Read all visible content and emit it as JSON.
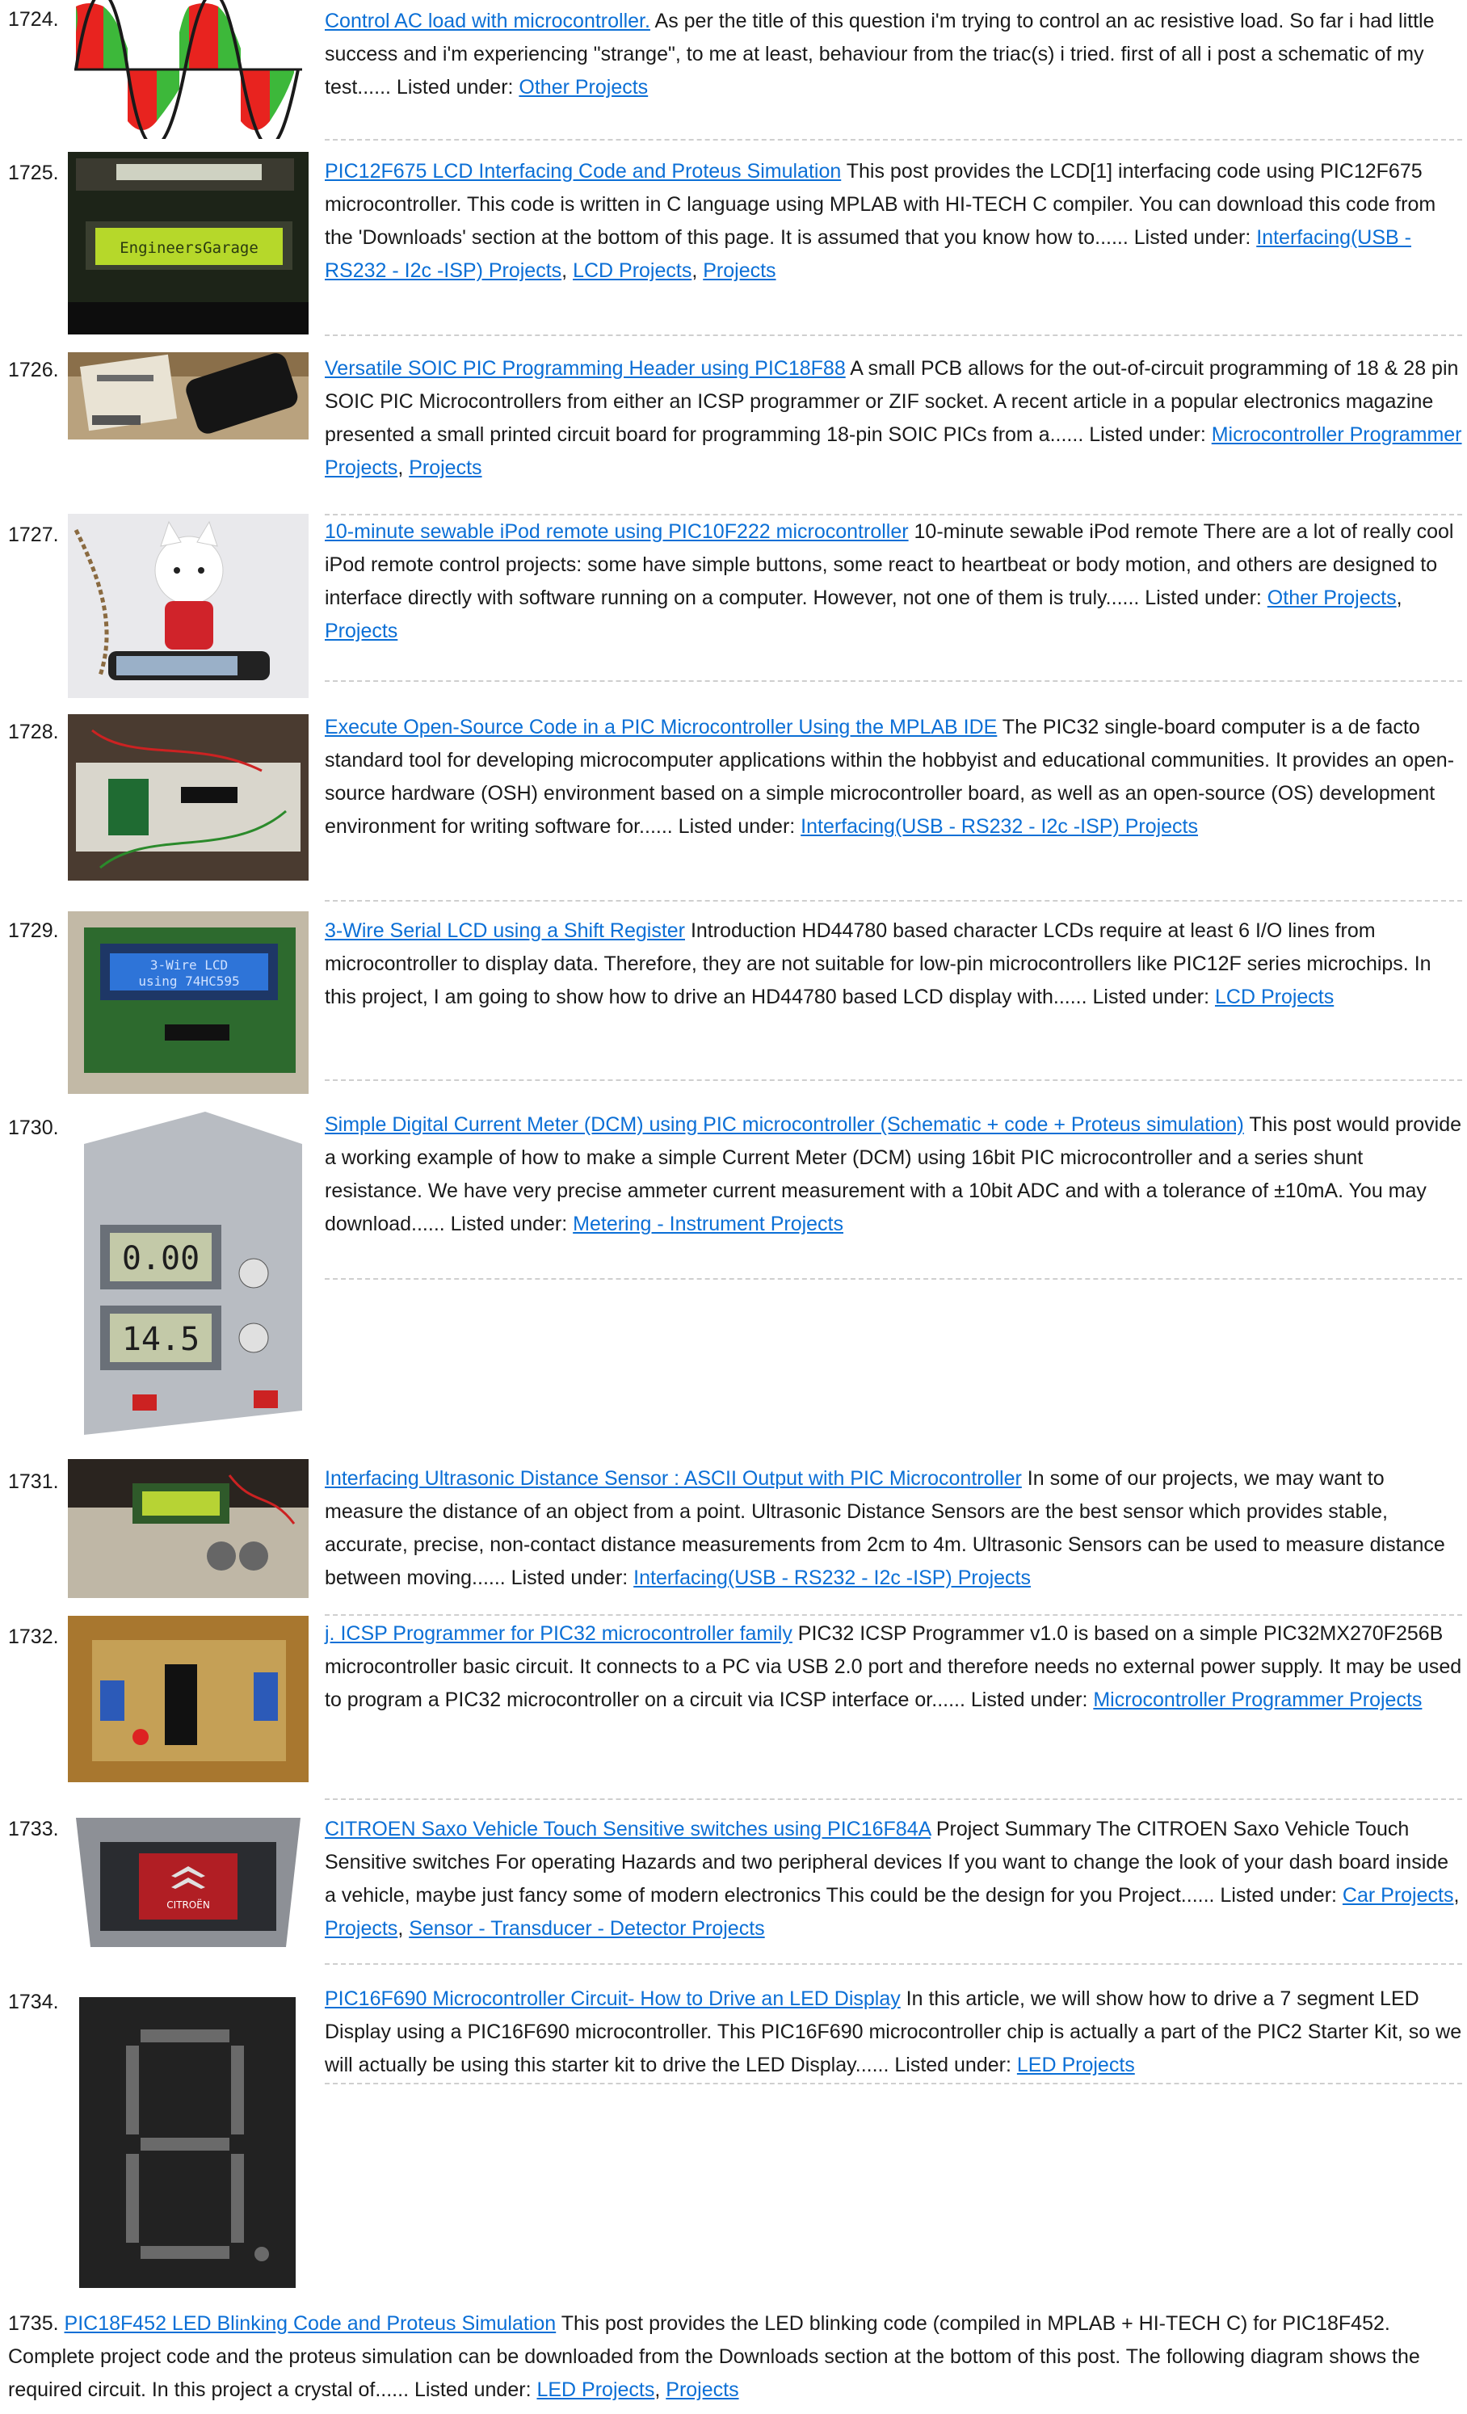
{
  "items": [
    {
      "number": "1724.",
      "title": "Control AC load with microcontroller.",
      "desc": " As per the title of this question i'm trying to control an ac resistive load. So far i had little success and i'm experiencing \"strange\", to me at least, behaviour from the triac(s) i tried. first of all i post a schematic of my test...... Listed under: ",
      "tags": [
        "Other Projects"
      ]
    },
    {
      "number": "1725.",
      "title": "PIC12F675 LCD Interfacing Code and Proteus Simulation",
      "desc": " This post provides the LCD[1] interfacing code using PIC12F675 microcontroller. This code is written in C language using MPLAB with HI-TECH C compiler. You can download this code from the 'Downloads' section at the bottom of this page. It is assumed that you know how to...... Listed under: ",
      "tags": [
        "Interfacing(USB - RS232 - I2c -ISP) Projects",
        "LCD Projects",
        "Projects"
      ],
      "image_text": "EngineersGarage"
    },
    {
      "number": "1726.",
      "title": "Versatile SOIC PIC Programming Header using PIC18F88",
      "desc": " A small PCB allows for the out-of-circuit programming of 18 & 28 pin SOIC PIC Microcontrollers from either an ICSP programmer or ZIF socket. A recent article in a popular electronics magazine presented a small printed circuit board for programming 18-pin SOIC PICs from a...... Listed under: ",
      "tags": [
        "Microcontroller Programmer Projects",
        "Projects"
      ]
    },
    {
      "number": "1727.",
      "title": "10-minute sewable iPod remote using PIC10F222 microcontroller",
      "desc": " 10-minute sewable iPod remote There are a lot of really cool iPod remote control projects: some have simple buttons, some react to  heartbeat or body motion, and others are designed to interface directly with software running on a computer. However, not one of them is truly...... Listed under: ",
      "tags": [
        "Other Projects",
        "Projects"
      ]
    },
    {
      "number": "1728.",
      "title": "Execute Open-Source Code in a PIC Microcontroller Using the MPLAB IDE",
      "desc": " The PIC32 single-board computer is a de facto standard tool for developing microcomputer applications within the hobbyist and educational communities. It provides an open-source hardware (OSH) environment based on a simple microcontroller board, as well as an open-source (OS) development environment for writing software for...... Listed under: ",
      "tags": [
        "Interfacing(USB - RS232 - I2c -ISP) Projects"
      ]
    },
    {
      "number": "1729.",
      "title": "3-Wire Serial LCD using a Shift Register",
      "desc": " Introduction HD44780 based character LCDs require at least 6 I/O lines from microcontroller to display data. Therefore, they are not suitable for low-pin microcontrollers like PIC12F series microchips. In this project, I am going to show how to drive an HD44780 based LCD display with...... Listed under: ",
      "tags": [
        "LCD Projects"
      ],
      "image_text_1": "3-Wire LCD",
      "image_text_2": "using 74HC595"
    },
    {
      "number": "1730.",
      "title": "Simple Digital Current Meter (DCM) using PIC microcontroller (Schematic + code + Proteus simulation)",
      "desc": " This post would provide a working example of how to make a simple Current Meter (DCM) using 16bit PIC microcontroller and a series shunt resistance. We have very precise ammeter current measurement with a 10bit ADC and with a tolerance of ±10mA. You may download...... Listed under: ",
      "tags": [
        "Metering - Instrument Projects"
      ],
      "image_text_1": "0.00",
      "image_text_2": "14.5"
    },
    {
      "number": "1731.",
      "title": "Interfacing Ultrasonic Distance Sensor : ASCII Output with PIC Microcontroller",
      "desc": " In some of our projects, we may want to measure the distance of an object from a point. Ultrasonic Distance Sensors are the best sensor which provides stable, accurate, precise, non-contact distance measurements from 2cm to 4m. Ultrasonic Sensors can be used to measure distance between moving...... Listed under: ",
      "tags": [
        "Interfacing(USB - RS232 - I2c -ISP) Projects"
      ]
    },
    {
      "number": "1732.",
      "title": "j. ICSP Programmer for PIC32 microcontroller family",
      "desc": " PIC32 ICSP Programmer v1.0 is based on a simple PIC32MX270F256B microcontroller basic circuit. It connects to a PC via USB 2.0 port and therefore needs no external power supply. It may be used to program a PIC32 microcontroller on a circuit via ICSP interface or...... Listed under: ",
      "tags": [
        "Microcontroller Programmer Projects"
      ]
    },
    {
      "number": "1733.",
      "title": "CITROEN Saxo Vehicle Touch Sensitive switches using PIC16F84A",
      "desc": " Project Summary The CITROEN Saxo Vehicle Touch Sensitive switches For operating Hazards and two peripheral devices If you want to change the look of your dash board inside a vehicle, maybe just fancy some of modern electronics This could be the design for you Project...... Listed under: ",
      "tags": [
        "Car Projects",
        "Projects",
        "Sensor - Transducer - Detector Projects"
      ],
      "image_text": "CITROËN"
    },
    {
      "number": "1734.",
      "title": "PIC16F690 Microcontroller Circuit- How to Drive an LED Display",
      "desc": " In this article, we will show how to drive a 7 segment LED Display using a PIC16F690 microcontroller. This PIC16F690 microcontroller chip is actually a part of the PIC2 Starter Kit, so we will actually be using this starter kit to drive the LED Display...... Listed under: ",
      "tags": [
        "LED Projects"
      ]
    },
    {
      "number": "1735.",
      "title": "PIC18F452 LED Blinking Code and Proteus Simulation",
      "desc": " This post provides the LED blinking code (compiled in MPLAB + HI-TECH C) for PIC18F452. Complete project code and the proteus simulation can be downloaded from the Downloads section at the bottom of this post. The following diagram shows the required circuit. In this project a crystal of...... Listed under: ",
      "tags": [
        "LED Projects",
        "Projects"
      ]
    }
  ]
}
